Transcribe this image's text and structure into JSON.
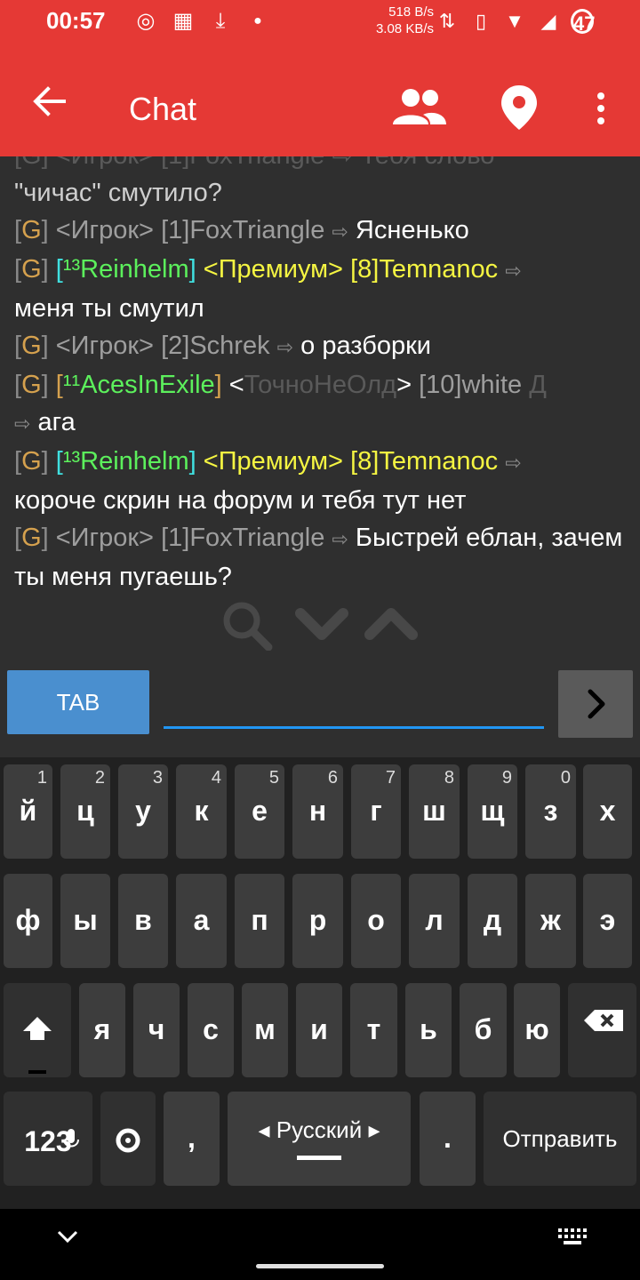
{
  "status_bar": {
    "time": "00:57",
    "net_up": "518 B/s",
    "net_down": "3.08 KB/s",
    "battery": "47",
    "color": "#e53935"
  },
  "app_bar": {
    "title": "Chat",
    "back_icon": "arrow-left-icon",
    "people_icon": "people-icon",
    "location_icon": "location-pin-icon",
    "more_icon": "more-vert-icon"
  },
  "chat": {
    "first_line_text": "\"чичас\" смутило?",
    "messages": [
      {
        "tag": "G",
        "prefix": "<Игрок>",
        "rank": "[1]",
        "nick": "FoxTriangle",
        "arrow": "⇨",
        "text": "Ясненько"
      },
      {
        "tag": "G",
        "bracket_open": "[",
        "level": "¹³",
        "name": "Reinhelm",
        "bracket_close": "]",
        "prefix": "<Премиум>",
        "rank": "[8]",
        "nick": "Temnanoc",
        "arrow": "⇨",
        "text": "меня ты смутил"
      },
      {
        "tag": "G",
        "prefix": "<Игрок>",
        "rank": "[2]",
        "nick": "Schrek",
        "arrow": "⇨",
        "text": "о разборки"
      },
      {
        "tag": "G",
        "bracket_open": "[",
        "level": "¹¹",
        "name": "AcesInExile",
        "bracket_close": "]",
        "prefix_open": "<",
        "prefix_inner": "ТочноНеОлд",
        "prefix_close": ">",
        "rank": "[10]",
        "nick": "white",
        "nick_suffix": "Д",
        "arrow": "⇨",
        "text": "ага"
      },
      {
        "tag": "G",
        "bracket_open": "[",
        "level": "¹³",
        "name": "Reinhelm",
        "bracket_close": "]",
        "prefix": "<Премиум>",
        "rank": "[8]",
        "nick": "Temnanoc",
        "arrow": "⇨",
        "text": "короче скрин на форум и тебя тут нет"
      },
      {
        "tag": "G",
        "prefix": "<Игрок>",
        "rank": "[1]",
        "nick": "FoxTriangle",
        "arrow": "⇨",
        "text": "Быстрей еблан, зачем ты меня пугаешь?"
      }
    ]
  },
  "controls": {
    "tab_label": "TAB",
    "input_value": "",
    "send_icon": "chevron-right-icon"
  },
  "keyboard": {
    "row1": [
      {
        "k": "й",
        "h": "1"
      },
      {
        "k": "ц",
        "h": "2"
      },
      {
        "k": "у",
        "h": "3"
      },
      {
        "k": "к",
        "h": "4"
      },
      {
        "k": "е",
        "h": "5"
      },
      {
        "k": "н",
        "h": "6"
      },
      {
        "k": "г",
        "h": "7"
      },
      {
        "k": "ш",
        "h": "8"
      },
      {
        "k": "щ",
        "h": "9"
      },
      {
        "k": "з",
        "h": "0"
      },
      {
        "k": "х",
        "h": ""
      }
    ],
    "row2": [
      "ф",
      "ы",
      "в",
      "а",
      "п",
      "р",
      "о",
      "л",
      "д",
      "ж",
      "э"
    ],
    "row3": [
      "я",
      "ч",
      "с",
      "м",
      "и",
      "т",
      "ь",
      "б",
      "ю"
    ],
    "numbers_label": "123",
    "comma": ",",
    "language": "Русский",
    "period": ".",
    "send_label": "Отправить"
  }
}
